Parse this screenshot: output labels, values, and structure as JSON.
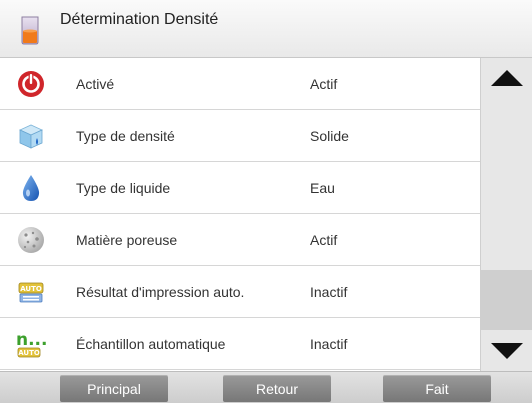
{
  "header": {
    "title": "Détermination Densité",
    "icon": "beaker-icon"
  },
  "rows": [
    {
      "label": "Activé",
      "value": "Actif",
      "icon": "power-icon"
    },
    {
      "label": "Type de densité",
      "value": "Solide",
      "icon": "solid-cube-icon"
    },
    {
      "label": "Type de liquide",
      "value": "Eau",
      "icon": "water-drop-icon"
    },
    {
      "label": "Matière poreuse",
      "value": "Actif",
      "icon": "porous-sphere-icon"
    },
    {
      "label": "Résultat d'impression auto.",
      "value": "Inactif",
      "icon": "auto-print-icon"
    },
    {
      "label": "Échantillon automatique",
      "value": "Inactif",
      "icon": "auto-sample-icon"
    }
  ],
  "scrollbar": {
    "up": "arrow-up-icon",
    "down": "arrow-down-icon"
  },
  "footer": {
    "main_label": "Principal",
    "back_label": "Retour",
    "done_label": "Fait"
  },
  "auto_badge": "AUTO",
  "auto_dots": "n...",
  "colors": {
    "power_red": "#d0262b",
    "drop_blue": "#1f66c8",
    "auto_green": "#3da02d"
  }
}
